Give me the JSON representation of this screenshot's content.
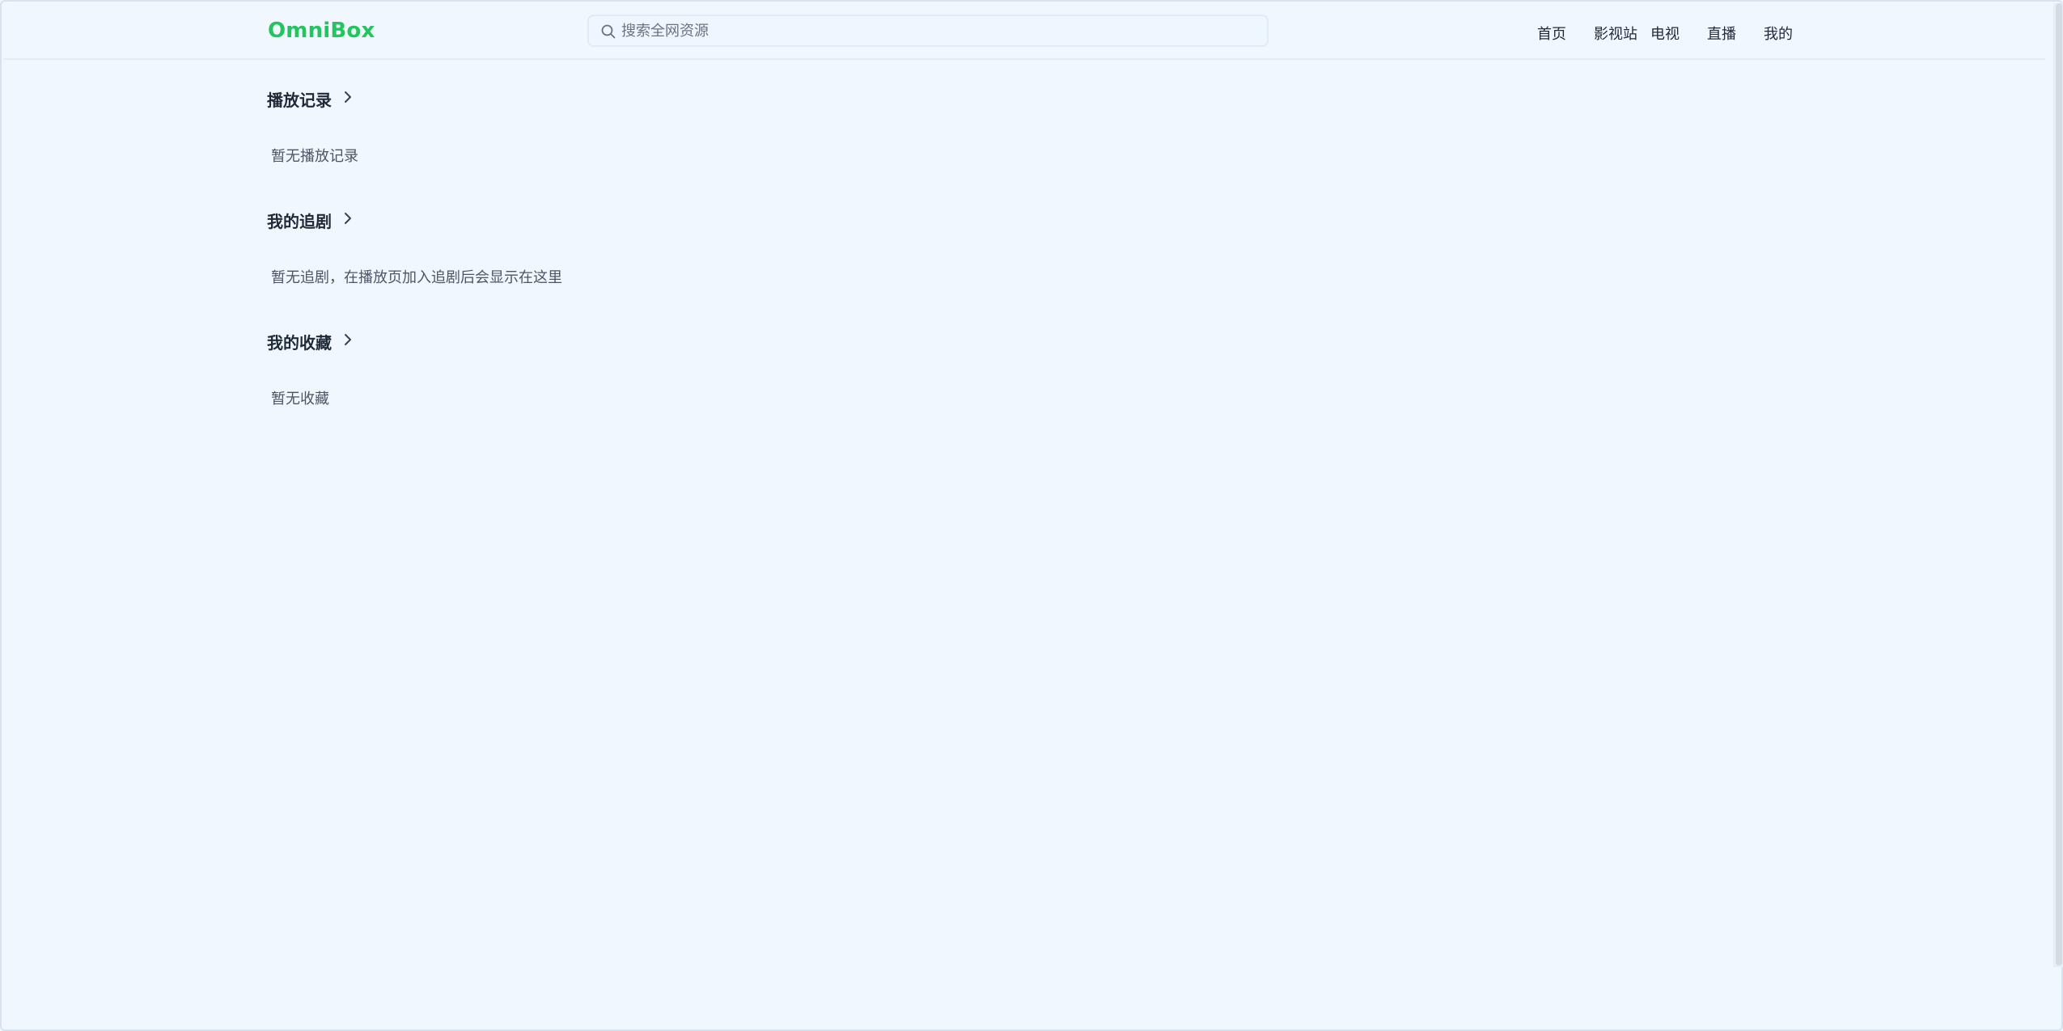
{
  "header": {
    "logo": "OmniBox",
    "search": {
      "placeholder": "搜索全网资源",
      "value": ""
    },
    "nav": [
      "首页",
      "影视站",
      "电视",
      "直播",
      "我的"
    ]
  },
  "sections": [
    {
      "title": "播放记录",
      "empty": "暂无播放记录"
    },
    {
      "title": "我的追剧",
      "empty": "暂无追剧，在播放页加入追剧后会显示在这里"
    },
    {
      "title": "我的收藏",
      "empty": "暂无收藏"
    }
  ],
  "colors": {
    "brand": "#22c55e",
    "background": "#f0f7ff",
    "text": "#1f2937",
    "muted": "#4b5563"
  },
  "icons": {
    "search": "search-icon",
    "chevron": "chevron-right-icon"
  }
}
